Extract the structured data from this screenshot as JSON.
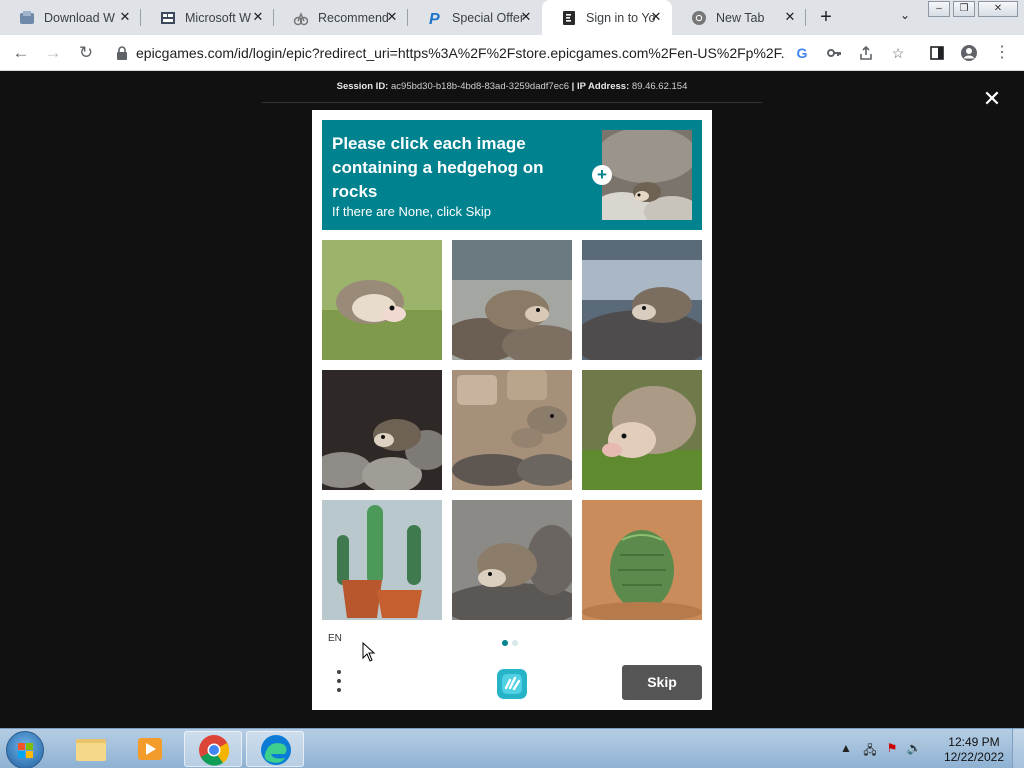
{
  "browser": {
    "tabs": [
      {
        "title": "Download W",
        "icon": "download-site-icon"
      },
      {
        "title": "Microsoft W",
        "icon": "microsoft-site-icon"
      },
      {
        "title": "Recommend",
        "icon": "recommend-site-icon"
      },
      {
        "title": "Special Offer",
        "icon": "paypal-icon"
      },
      {
        "title": "Sign in to Yo",
        "icon": "epic-games-icon",
        "active": true
      },
      {
        "title": "New Tab",
        "icon": "chrome-icon"
      }
    ],
    "url": "epicgames.com/id/login/epic?redirect_uri=https%3A%2F%2Fstore.epicgames.com%2Fen-US%2Fp%2F..."
  },
  "page": {
    "session_label": "Session ID:",
    "session_id": "ac95bd30-b18b-4bd8-83ad-3259dadf7ec6",
    "separator": "|",
    "ip_label": "IP Address:",
    "ip": "89.46.62.154"
  },
  "captcha": {
    "prompt": "Please click each image containing a hedgehog on rocks",
    "sub_prompt": "If there are None, click Skip",
    "tiles": [
      {
        "subject": "hedgehog on grass"
      },
      {
        "subject": "hedgehog on rocks"
      },
      {
        "subject": "hedgehog on rocks by water"
      },
      {
        "subject": "hedgehog among dark rocks"
      },
      {
        "subject": "two hedgehogs on rocks"
      },
      {
        "subject": "hedgehog on grass close-up"
      },
      {
        "subject": "potted cacti"
      },
      {
        "subject": "hedgehog on rocks"
      },
      {
        "subject": "cactus in sand"
      }
    ],
    "language": "EN",
    "skip_label": "Skip",
    "page_indicator": {
      "current": 1,
      "total": 2
    },
    "accent_color": "#00838f"
  },
  "taskbar": {
    "apps": [
      "file-explorer",
      "media-player",
      "chrome",
      "edge"
    ],
    "time": "12:49 PM",
    "date": "12/22/2022"
  }
}
